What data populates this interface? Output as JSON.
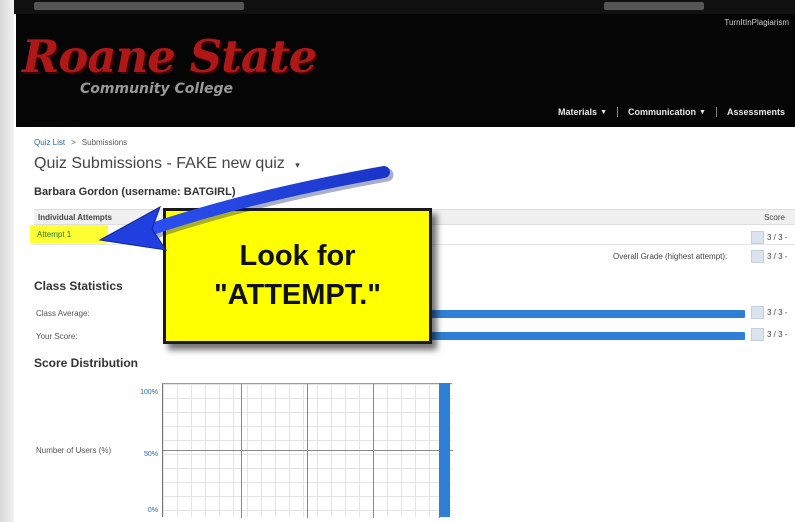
{
  "header": {
    "user_label": "TurnItInPlagiarism",
    "logo_main": "Roane State",
    "logo_sub": "Community College",
    "nav": [
      "Materials",
      "Communication",
      "Assessments"
    ]
  },
  "breadcrumb": {
    "root": "Quiz List",
    "separator": ">",
    "current": "Submissions"
  },
  "page": {
    "title": "Quiz Submissions - FAKE new quiz",
    "title_caret": "▾",
    "student": "Barbara Gordon (username: BATGIRL)"
  },
  "attempts_table": {
    "col_attempts": "Individual Attempts",
    "col_score": "Score",
    "rows": [
      {
        "label": "Attempt 1",
        "score": "3 / 3 -"
      }
    ],
    "overall_label": "Overall Grade (highest attempt):",
    "overall_score": "3 / 3 -"
  },
  "class_statistics": {
    "heading": "Class Statistics",
    "class_average_label": "Class Average:",
    "class_average_score": "3 / 3 -",
    "your_score_label": "Your Score:",
    "your_score": "3 / 3 -"
  },
  "score_distribution": {
    "heading": "Score Distribution",
    "y_axis_label": "Number of Users (%)",
    "y_ticks": [
      "100%",
      "50%",
      "0%"
    ]
  },
  "callout": {
    "line1": "Look for",
    "line2": "\"ATTEMPT.\""
  },
  "colors": {
    "header_bg": "#050505",
    "logo_red": "#b01818",
    "bar_blue": "#2f7fd6",
    "highlight_yellow": "#ffff33",
    "arrow_blue": "#1f3fe0"
  }
}
